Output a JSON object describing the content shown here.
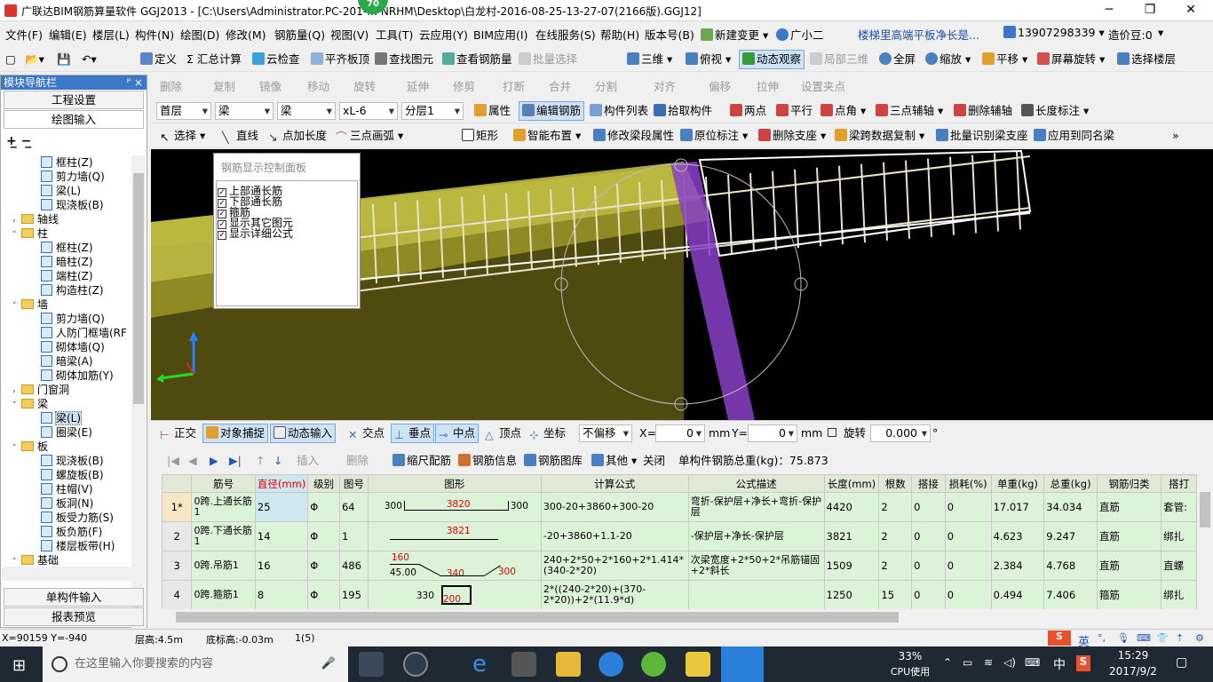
{
  "titlebar": {
    "title": "广联达BIM钢筋算量软件 GGJ2013 - [C:\\Users\\Administrator.PC-201-… NRHM\\Desktop\\白龙村-2016-08-25-13-27-07(2166版).GGJ12]",
    "badge": "70",
    "min": "─",
    "restore": "❐",
    "close": "✕"
  },
  "menubar": {
    "items": [
      "文件(F)",
      "编辑(E)",
      "楼层(L)",
      "构件(N)",
      "绘图(D)",
      "修改(M)",
      "钢筋量(Q)",
      "视图(V)",
      "工具(T)",
      "云应用(Y)",
      "BIM应用(I)",
      "在线服务(S)",
      "帮助(H)",
      "版本号(B)",
      "新建变更",
      "广小二",
      "楼梯里高端平板净长是...",
      "13907298339",
      "造价豆:0"
    ]
  },
  "toolbar1": {
    "items": [
      "定义",
      "Σ 汇总计算",
      "云检查",
      "平齐板顶",
      "查找图元",
      "查看钢筋量",
      "批量选择",
      "三维",
      "俯视",
      "动态观察",
      "局部三维",
      "全屏",
      "缩放",
      "平移",
      "屏幕旋转",
      "选择楼层"
    ]
  },
  "toolbar2": {
    "items": [
      "删除",
      "复制",
      "镜像",
      "移动",
      "旋转",
      "延伸",
      "修剪",
      "打断",
      "合并",
      "分割",
      "对齐",
      "偏移",
      "拉伸",
      "设置夹点"
    ]
  },
  "toolbar3": {
    "floor": "首层",
    "type1": "梁",
    "type2": "梁",
    "name": "xL-6",
    "layer": "分层1",
    "items": [
      "属性",
      "编辑钢筋",
      "构件列表",
      "拾取构件",
      "两点",
      "平行",
      "点角",
      "三点辅轴",
      "删除辅轴",
      "长度标注"
    ]
  },
  "toolbar4": {
    "items": [
      "选择",
      "直线",
      "点加长度",
      "三点画弧",
      "矩形",
      "智能布置",
      "修改梁段属性",
      "原位标注",
      "删除支座",
      "梁跨数据复制",
      "批量识别梁支座",
      "应用到同名梁"
    ]
  },
  "leftpanel": {
    "title": "模块导航栏",
    "pin": "ᴾ ×",
    "btn_project": "工程设置",
    "btn_draw": "绘图输入",
    "btn_single": "单构件输入",
    "btn_report": "报表预览",
    "tree": [
      {
        "l": "框柱(Z)",
        "k": "c",
        "d": 3
      },
      {
        "l": "剪力墙(Q)",
        "k": "c",
        "d": 3
      },
      {
        "l": "梁(L)",
        "k": "c",
        "d": 3
      },
      {
        "l": "现浇板(B)",
        "k": "c",
        "d": 3
      },
      {
        "l": "轴线",
        "k": "f",
        "d": 1,
        "t": "›"
      },
      {
        "l": "柱",
        "k": "f",
        "d": 1,
        "t": "˅"
      },
      {
        "l": "框柱(Z)",
        "k": "c",
        "d": 3
      },
      {
        "l": "暗柱(Z)",
        "k": "c",
        "d": 3
      },
      {
        "l": "端柱(Z)",
        "k": "c",
        "d": 3
      },
      {
        "l": "构造柱(Z)",
        "k": "c",
        "d": 3
      },
      {
        "l": "墙",
        "k": "f",
        "d": 1,
        "t": "˅"
      },
      {
        "l": "剪力墙(Q)",
        "k": "c",
        "d": 3
      },
      {
        "l": "人防门框墙(RF",
        "k": "c",
        "d": 3
      },
      {
        "l": "砌体墙(Q)",
        "k": "c",
        "d": 3
      },
      {
        "l": "暗梁(A)",
        "k": "c",
        "d": 3
      },
      {
        "l": "砌体加筋(Y)",
        "k": "c",
        "d": 3
      },
      {
        "l": "门窗洞",
        "k": "f",
        "d": 1,
        "t": "›"
      },
      {
        "l": "梁",
        "k": "f",
        "d": 1,
        "t": "˅"
      },
      {
        "l": "梁(L)",
        "k": "c",
        "d": 3,
        "h": true
      },
      {
        "l": "圈梁(E)",
        "k": "c",
        "d": 3
      },
      {
        "l": "板",
        "k": "f",
        "d": 1,
        "t": "˅"
      },
      {
        "l": "现浇板(B)",
        "k": "c",
        "d": 3
      },
      {
        "l": "螺旋板(B)",
        "k": "c",
        "d": 3
      },
      {
        "l": "柱帽(V)",
        "k": "c",
        "d": 3
      },
      {
        "l": "板洞(N)",
        "k": "c",
        "d": 3
      },
      {
        "l": "板受力筋(S)",
        "k": "c",
        "d": 3
      },
      {
        "l": "板负筋(F)",
        "k": "c",
        "d": 3
      },
      {
        "l": "楼层板带(H)",
        "k": "c",
        "d": 3
      },
      {
        "l": "基础",
        "k": "f",
        "d": 1,
        "t": "˅"
      }
    ]
  },
  "ctrlpanel": {
    "title": "钢筋显示控制面板",
    "items": [
      "上部通长筋",
      "下部通长筋",
      "箍筋",
      "显示其它图元",
      "显示详细公式"
    ]
  },
  "snapbar": {
    "items": [
      "正交",
      "对象捕捉",
      "动态输入",
      "交点",
      "垂点",
      "中点",
      "顶点",
      "坐标"
    ],
    "offset": "不偏移",
    "x_label": "X=",
    "x": "0",
    "mm1": "mm",
    "y_label": "Y=",
    "y": "0",
    "mm2": "mm",
    "rotate": "旋转",
    "angle": "0.000",
    "deg": "°"
  },
  "rebarbar": {
    "items": [
      "插入",
      "删除",
      "缩尺配筋",
      "钢筋信息",
      "钢筋图库",
      "其他",
      "关闭"
    ],
    "total": "单构件钢筋总重(kg)：75.873"
  },
  "grid": {
    "columns": [
      "",
      "筋号",
      "直径(mm)",
      "级别",
      "图号",
      "图形",
      "计算公式",
      "公式描述",
      "长度(mm)",
      "根数",
      "搭接",
      "损耗(%)",
      "单重(kg)",
      "总重(kg)",
      "钢筋归类",
      "搭打"
    ],
    "rows": [
      {
        "n": "1*",
        "name": "0跨.上通长筋1",
        "dia": "25",
        "grade": "Φ",
        "fig": "64",
        "shape": [
          "300",
          "3820",
          "300"
        ],
        "formula": "300-20+3860+300-20",
        "desc": "弯折-保护层+净长+弯折-保护层",
        "len": "4420",
        "cnt": "2",
        "lap": "0",
        "loss": "0",
        "unit": "17.017",
        "total": "34.034",
        "cls": "直筋",
        "tie": "套管:"
      },
      {
        "n": "2",
        "name": "0跨.下通长筋1",
        "dia": "14",
        "grade": "Φ",
        "fig": "1",
        "shape": [
          "3821"
        ],
        "formula": "-20+3860+1.1-20",
        "desc": "-保护层+净长-保护层",
        "len": "3821",
        "cnt": "2",
        "lap": "0",
        "loss": "0",
        "unit": "4.623",
        "total": "9.247",
        "cls": "直筋",
        "tie": "绑扎"
      },
      {
        "n": "3",
        "name": "0跨.吊筋1",
        "dia": "16",
        "grade": "Φ",
        "fig": "486",
        "shape": [
          "160",
          "45.00",
          "340",
          "300"
        ],
        "formula": "240+2*50+2*160+2*1.414*(340-2*20)",
        "desc": "次梁宽度+2*50+2*吊筋锚固+2*斜长",
        "len": "1509",
        "cnt": "2",
        "lap": "0",
        "loss": "0",
        "unit": "2.384",
        "total": "4.768",
        "cls": "直筋",
        "tie": "直螺"
      },
      {
        "n": "4",
        "name": "0跨.箍筋1",
        "dia": "8",
        "grade": "Φ",
        "fig": "195",
        "shape": [
          "330",
          "200"
        ],
        "formula": "2*((240-2*20)+(370-2*20))+2*(11.9*d)",
        "desc": "",
        "len": "1250",
        "cnt": "15",
        "lap": "0",
        "loss": "0",
        "unit": "0.494",
        "total": "7.406",
        "cls": "箍筋",
        "tie": "绑扎"
      }
    ]
  },
  "statusbar": {
    "coords": "X=90159 Y=-940",
    "floor_h": "层高:4.5m",
    "base_h": "底标高:-0.03m",
    "count": "1(5)"
  },
  "taskbar": {
    "search": "在这里输入你要搜索的内容",
    "cpu": "33%",
    "cpu_label": "CPU使用",
    "ime": "中",
    "time": "15:29",
    "date": "2017/9/2"
  },
  "sogou": {
    "lang": "英"
  },
  "colors": {
    "accent": "#3c78c8",
    "grid_row": "#ddf3d9",
    "beam": "#d6d35a",
    "viewport": "#000000"
  }
}
